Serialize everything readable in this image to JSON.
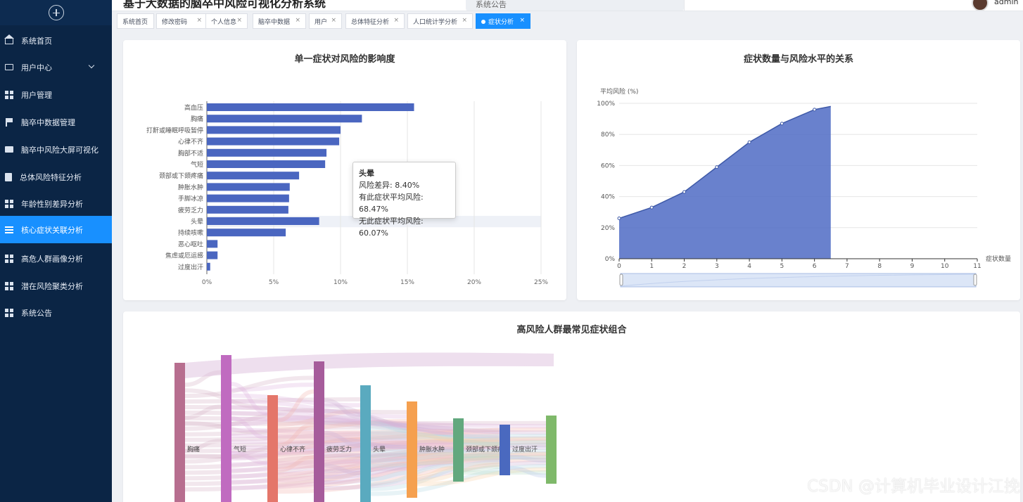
{
  "header": {
    "title": "基于大数据的脑卒中风险可视化分析系统",
    "notice": "系统公告",
    "user": "admin"
  },
  "sidebar": {
    "items": [
      {
        "label": "系统首页",
        "icon": "home-icon"
      },
      {
        "label": "用户中心",
        "icon": "user-center-icon"
      },
      {
        "label": "用户管理",
        "icon": "grid-icon"
      },
      {
        "label": "脑卒中数据管理",
        "icon": "flag-icon"
      },
      {
        "label": "脑卒中风险大屏可视化",
        "icon": "chat-icon"
      },
      {
        "label": "总体风险特征分析",
        "icon": "document-icon"
      },
      {
        "label": "年龄性别差异分析",
        "icon": "grid-icon"
      },
      {
        "label": "核心症状关联分析",
        "icon": "list-icon",
        "active": true
      },
      {
        "label": "高危人群画像分析",
        "icon": "grid-icon"
      },
      {
        "label": "潜在风险聚类分析",
        "icon": "grid-icon"
      },
      {
        "label": "系统公告",
        "icon": "grid-icon"
      }
    ]
  },
  "tabs": [
    {
      "label": "系统首页"
    },
    {
      "label": "修改密码"
    },
    {
      "label": "个人信息"
    },
    {
      "label": "脑卒中数据"
    },
    {
      "label": "用户"
    },
    {
      "label": "总体特征分析"
    },
    {
      "label": "人口统计学分析"
    },
    {
      "label": "症状分析",
      "active": true
    }
  ],
  "tab_close": "×",
  "chart_data": [
    {
      "type": "bar",
      "title": "单一症状对风险的影响度",
      "orientation": "horizontal",
      "categories": [
        "高血压",
        "胸痛",
        "打鼾或睡眠呼吸暂停",
        "心律不齐",
        "胸部不适",
        "气短",
        "颈部或下颌疼痛",
        "肿胀水肿",
        "手脚冰凉",
        "疲劳乏力",
        "头晕",
        "持续咳嗽",
        "恶心呕吐",
        "焦虑或厄运感",
        "过度出汗"
      ],
      "values": [
        15.5,
        11.6,
        10.0,
        9.9,
        8.95,
        8.85,
        6.9,
        6.2,
        6.15,
        6.1,
        8.4,
        5.9,
        0.8,
        0.8,
        0.25
      ],
      "xlim": [
        0,
        25
      ],
      "xticks": [
        "0%",
        "5%",
        "10%",
        "15%",
        "20%",
        "25%"
      ],
      "color": "#4a66c0",
      "tooltip": {
        "title": "头晕",
        "lines": [
          "风险差异: 8.40%",
          "有此症状平均风险: 68.47%",
          "无此症状平均风险: 60.07%"
        ]
      }
    },
    {
      "type": "area",
      "title": "症状数量与风险水平的关系",
      "ylabel": "平均风险 (%)",
      "xlabel": "症状数量",
      "x": [
        0,
        1,
        2,
        3,
        4,
        5,
        6,
        6.5
      ],
      "y": [
        26,
        33,
        43,
        59,
        75,
        87,
        96,
        98
      ],
      "xlim": [
        0,
        11
      ],
      "ylim": [
        0,
        100
      ],
      "yticks": [
        "0%",
        "20%",
        "40%",
        "60%",
        "80%",
        "100%"
      ],
      "xticks": [
        "0",
        "1",
        "2",
        "3",
        "4",
        "5",
        "6",
        "7",
        "8",
        "9",
        "10",
        "11"
      ],
      "color": "#5470c6",
      "grid": true
    },
    {
      "type": "sankey",
      "title": "高风险人群最常见症状组合",
      "nodes": [
        {
          "name": "胸痛",
          "color": "#b76e8f"
        },
        {
          "name": "气短",
          "color": "#c06bc0"
        },
        {
          "name": "心律不齐",
          "color": "#e4766a"
        },
        {
          "name": "疲劳乏力",
          "color": "#a65c9b"
        },
        {
          "name": "头晕",
          "color": "#5aaabf"
        },
        {
          "name": "肿胀水肿",
          "color": "#f5a04f"
        },
        {
          "name": "颈部或下颌疼痛",
          "color": "#62a87e"
        },
        {
          "name": "过度出汗",
          "color": "#4a69bf"
        },
        {
          "name": "",
          "color": "#7fb96a"
        }
      ]
    }
  ],
  "watermark": "CSDN @计算机毕业设计江挽"
}
